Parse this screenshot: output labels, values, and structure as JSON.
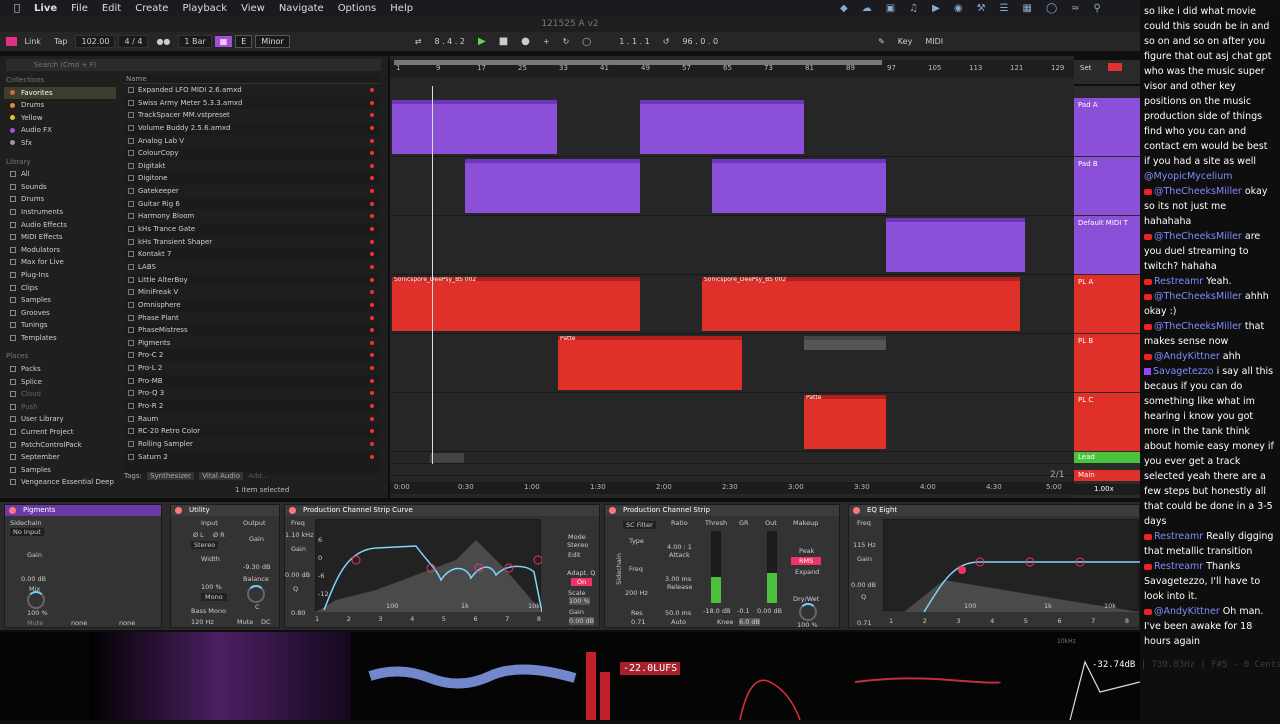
{
  "menubar": {
    "app": "Live",
    "items": [
      "File",
      "Edit",
      "Create",
      "Playback",
      "View",
      "Navigate",
      "Options",
      "Help"
    ]
  },
  "title": "121525 A v2",
  "transport": {
    "link": "Link",
    "tap": "Tap",
    "bpm": "102.00",
    "sig": "4 / 4",
    "quant": "1 Bar",
    "key": "E",
    "scale": "Minor",
    "position": "8 .  4 .  2",
    "loop_start": "1 .  1 .  1",
    "loop_len": "96 .  0 .  0",
    "key_btn": "Key",
    "midi_btn": "MIDI"
  },
  "browser": {
    "search_placeholder": "Search (Cmd + F)",
    "collections_header": "Collections",
    "collections": [
      {
        "label": "Favorites",
        "color": "#e0623a"
      },
      {
        "label": "Drums",
        "color": "#e58a2a"
      },
      {
        "label": "Yellow",
        "color": "#e6c22a"
      },
      {
        "label": "Audio FX",
        "color": "#a64fd6"
      },
      {
        "label": "Sfx",
        "color": "#9a9a9a"
      }
    ],
    "library_header": "Library",
    "library": [
      "All",
      "Sounds",
      "Drums",
      "Instruments",
      "Audio Effects",
      "MIDI Effects",
      "Modulators",
      "Max for Live",
      "Plug-Ins",
      "Clips",
      "Samples",
      "Grooves",
      "Tunings",
      "Templates"
    ],
    "places_header": "Places",
    "places": [
      "Packs",
      "Splice",
      "Cloud",
      "Push",
      "User Library",
      "Current Project",
      "PatchControlPack",
      "September",
      "Samples",
      "Vengeance Essential Deep h"
    ],
    "name_header": "Name",
    "files": [
      "Expanded LFO MIDI 2.6.amxd",
      "Swiss Army Meter 5.3.3.amxd",
      "TrackSpacer MM.vstpreset",
      "Volume Buddy 2.5.6.amxd",
      "Analog Lab V",
      "ColourCopy",
      "Digitakt",
      "Digitone",
      "Gatekeeper",
      "Guitar Rig 6",
      "Harmony Bloom",
      "kHs Trance Gate",
      "kHs Transient Shaper",
      "Kontakt 7",
      "LABS",
      "Little AlterBoy",
      "MiniFreak V",
      "Omnisphere",
      "Phase Plant",
      "PhaseMistress",
      "Pigments",
      "Pro-C 2",
      "Pro-L 2",
      "Pro-MB",
      "Pro-Q 3",
      "Pro-R 2",
      "Raum",
      "RC-20 Retro Color",
      "Rolling Sampler",
      "Saturn 2"
    ],
    "tags_label": "Tags:",
    "tags": [
      "Synthesizer",
      "Vital Audio",
      "Add..."
    ]
  },
  "arrangement": {
    "bars": [
      "1",
      "9",
      "17",
      "25",
      "33",
      "41",
      "49",
      "57",
      "65",
      "73",
      "81",
      "89",
      "97",
      "105",
      "113",
      "121",
      "129"
    ],
    "set_label": "Set",
    "clip_names": {
      "sonic1": "Sonicspore_DeePsy_BS 002",
      "sonic2": "Sonicspore_DeePsy_BS 002",
      "sonic3": "Sonicspore_DeePsy_BS 002",
      "sonic4": "Sonicspore_DeePsy_BS 002",
      "patt": "Patte"
    },
    "times": [
      "0:00",
      "0:30",
      "1:00",
      "1:30",
      "2:00",
      "2:30",
      "3:00",
      "3:30",
      "4:00",
      "4:30",
      "5:00"
    ],
    "zoom_ratio": "2/1",
    "tracks": [
      {
        "name": "Pad A",
        "color": "#8b4fd8"
      },
      {
        "name": "Pad B",
        "color": "#8b4fd8"
      },
      {
        "name": "Default MIDI T",
        "color": "#8b4fd8"
      },
      {
        "name": "PL A",
        "color": "#e0302a"
      },
      {
        "name": "PL B",
        "color": "#e0302a"
      },
      {
        "name": "PL C",
        "color": "#e0302a"
      },
      {
        "name": "Lead",
        "color": "#49c43a"
      },
      {
        "name": "Main",
        "color": "#e0302a"
      }
    ]
  },
  "status": {
    "selection": "1 item selected",
    "zoom": "1.00x"
  },
  "devices": {
    "pigments": {
      "title": "Pigments",
      "sidechain": "Sidechain",
      "no_input": "No Input",
      "gain": "Gain",
      "gain_val": "0.00 dB",
      "mix": "Mix",
      "mix_val": "100 %",
      "mute": "Mute",
      "none1": "none",
      "none2": "none"
    },
    "utility": {
      "title": "Utility",
      "input": "Input",
      "output": "Output",
      "left": "Ø L",
      "right": "Ø R",
      "stereo": "Stereo",
      "gain": "Gain",
      "gain_val": "-9.30 dB",
      "width": "Width",
      "width_val": "100 %",
      "mono": "Mono",
      "balance": "Balance",
      "bass_mono": "Bass Mono",
      "bass_freq": "120 Hz",
      "mute": "Mute",
      "dc": "DC",
      "c": "C"
    },
    "curve": {
      "title": "Production Channel Strip Curve",
      "freq": "Freq",
      "freq_val": "1.10 kHz",
      "gain": "Gain",
      "gain_val": "0.00 dB",
      "q": "Q",
      "q_val": "0.80",
      "mode": "Mode",
      "mode_val": "Stereo",
      "edit": "Edit",
      "adaptq": "Adapt. Q",
      "on": "On",
      "scale": "Scale",
      "scale_val": "100 %",
      "g2": "Gain",
      "g2_val": "0.00 dB",
      "l6": "6",
      "l0": "0",
      "lm6": "-6",
      "l12": "-12",
      "f100": "100",
      "f1k": "1k",
      "f10k": "10k",
      "bands": [
        "1",
        "2",
        "3",
        "4",
        "5",
        "6",
        "7",
        "8"
      ]
    },
    "strip": {
      "title": "Production Channel Strip",
      "sc_filter": "SC Filter",
      "type": "Type",
      "freq": "Freq",
      "freq_val": "200 Hz",
      "res": "Res",
      "res_val": "0.71",
      "ratio": "Ratio",
      "ratio_val": "4.00 : 1",
      "attack": "Attack",
      "attack_val": "3.00 ms",
      "release": "Release",
      "release_val": "50.0 ms",
      "auto": "Auto",
      "thresh": "Thresh",
      "thresh_val": "-18.0 dB",
      "gr": "GR",
      "gr_val": "-0.1",
      "out": "Out",
      "out_val": "0.00 dB",
      "knee": "Knee",
      "knee_val": "6.0 dB",
      "makeup": "Makeup",
      "peak": "Peak",
      "rms": "RMS",
      "expand": "Expand",
      "drywet": "Dry/Wet",
      "drywet_val": "100 %",
      "sidechain": "Sidechain"
    },
    "eq": {
      "title": "EQ Eight",
      "freq": "Freq",
      "freq_val": "115 Hz",
      "gain": "Gain",
      "gain_val": "0.00 dB",
      "q": "Q",
      "q_val": "0.71",
      "f100": "100",
      "f1k": "1k",
      "f10k": "10k",
      "bands": [
        "1",
        "2",
        "3",
        "4",
        "5",
        "6",
        "7",
        "8"
      ]
    }
  },
  "visualizer": {
    "lufs": "-22.0LUFS",
    "pitch": "-32.74dB | 739.83Hz | F#5 - 0 Cents",
    "peak": "10kHz"
  },
  "chat": [
    {
      "text": "so like i did what movie could this soudn be in and so on and so on after you figure that out asj chat gpt who was the music super visor and other key positions on the music production side of things find who you can and contact em would be best if you had a site as well"
    },
    {
      "user": "@MyopicMycelium",
      "src": "none",
      "text": ""
    },
    {
      "user": "@TheCheeksMiller",
      "src": "yt",
      "text": "okay so its not just me hahahaha"
    },
    {
      "user": "@TheCheeksMiller",
      "src": "yt",
      "text": "are you duel streaming to twitch? hahaha"
    },
    {
      "user": "Restreamr",
      "src": "yt",
      "text": "Yeah."
    },
    {
      "user": "@TheCheeksMiller",
      "src": "yt",
      "text": "ahhh okay :)"
    },
    {
      "user": "@TheCheeksMiller",
      "src": "yt",
      "text": "that makes sense now"
    },
    {
      "user": "@AndyKittner",
      "src": "yt",
      "text": "ahh"
    },
    {
      "user": "Savagetezzo",
      "src": "ttv",
      "text": "i say all this becaus if you can do something like what im hearing i know you got more in the tank think about homie easy money if you ever get a track selected yeah there are a few steps but honestly all that could be done in a 3-5 days"
    },
    {
      "user": "Restreamr",
      "src": "yt",
      "text": "Really digging that metallic transition"
    },
    {
      "user": "Restreamr",
      "src": "yt",
      "text": "Thanks Savagetezzo, I'll have to look into it."
    },
    {
      "user": "@AndyKittner",
      "src": "yt",
      "text": "Oh man. I've been awake for 18 hours again"
    }
  ]
}
